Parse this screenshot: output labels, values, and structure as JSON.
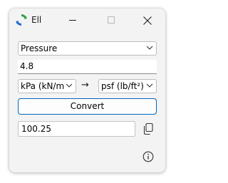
{
  "window": {
    "title": "Ell",
    "icon": "app-refresh-icon"
  },
  "controls": {
    "quantity_selected": "Pressure",
    "input_value": "4.8",
    "from_unit": "kPa (kN/m²)",
    "arrow": "→",
    "to_unit": "psf (lb/ft²)",
    "convert_label": "Convert",
    "output_value": "100.25"
  },
  "icons": {
    "minimize": "minimize-icon",
    "maximize": "maximize-icon",
    "close": "close-icon",
    "dropdown": "chevron-down-icon",
    "copy": "copy-icon",
    "info": "info-icon"
  },
  "colors": {
    "accent": "#0067c0",
    "icon_green": "#2e9e4f",
    "icon_blue": "#1f6fd1"
  }
}
